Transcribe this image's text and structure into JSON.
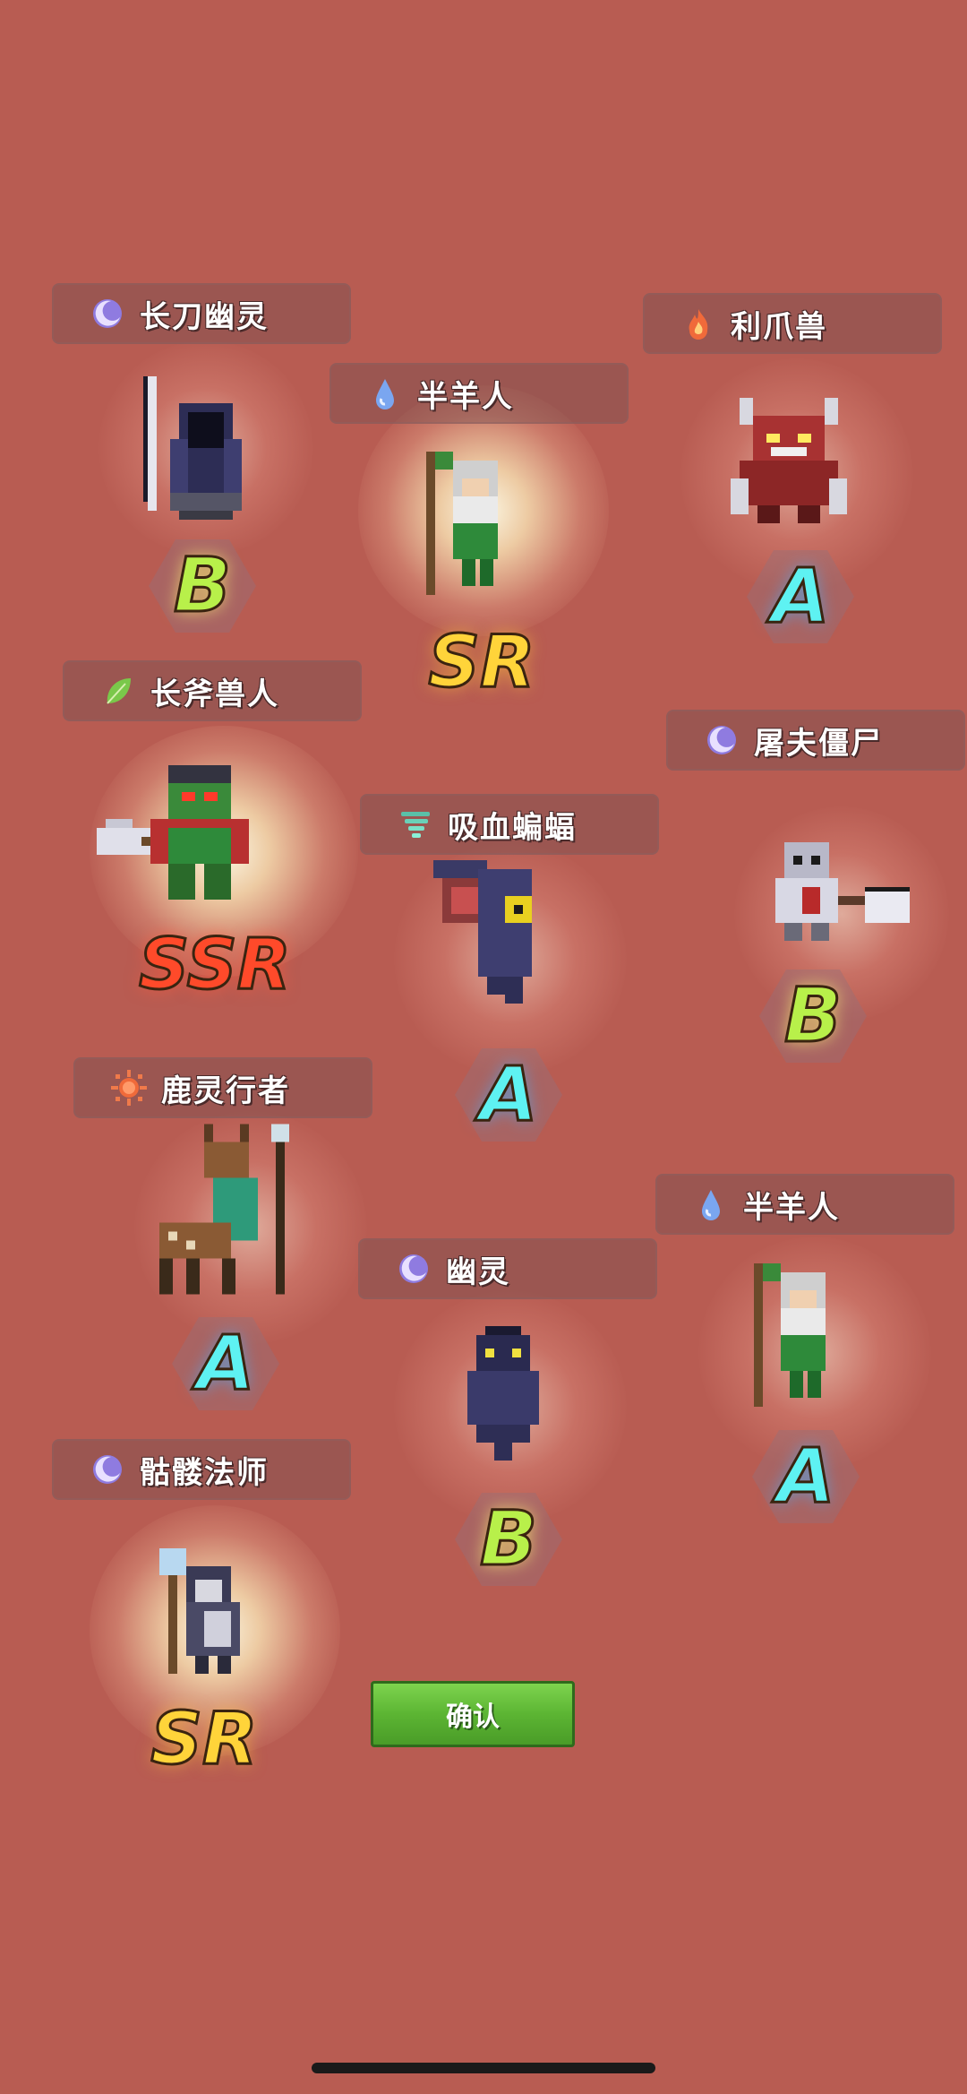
{
  "units": [
    {
      "name": "长刀幽灵",
      "element": "moon",
      "grade": "B"
    },
    {
      "name": "半羊人",
      "element": "water",
      "grade": "SR"
    },
    {
      "name": "利爪兽",
      "element": "fire",
      "grade": "A"
    },
    {
      "name": "长斧兽人",
      "element": "leaf",
      "grade": "SSR"
    },
    {
      "name": "屠夫僵尸",
      "element": "moon",
      "grade": "B"
    },
    {
      "name": "吸血蝙蝠",
      "element": "wind",
      "grade": "A"
    },
    {
      "name": "鹿灵行者",
      "element": "sun",
      "grade": "A"
    },
    {
      "name": "半羊人",
      "element": "water",
      "grade": "A"
    },
    {
      "name": "幽灵",
      "element": "moon",
      "grade": "B"
    },
    {
      "name": "骷髅法师",
      "element": "moon",
      "grade": "SR"
    }
  ],
  "confirm_label": "确认"
}
